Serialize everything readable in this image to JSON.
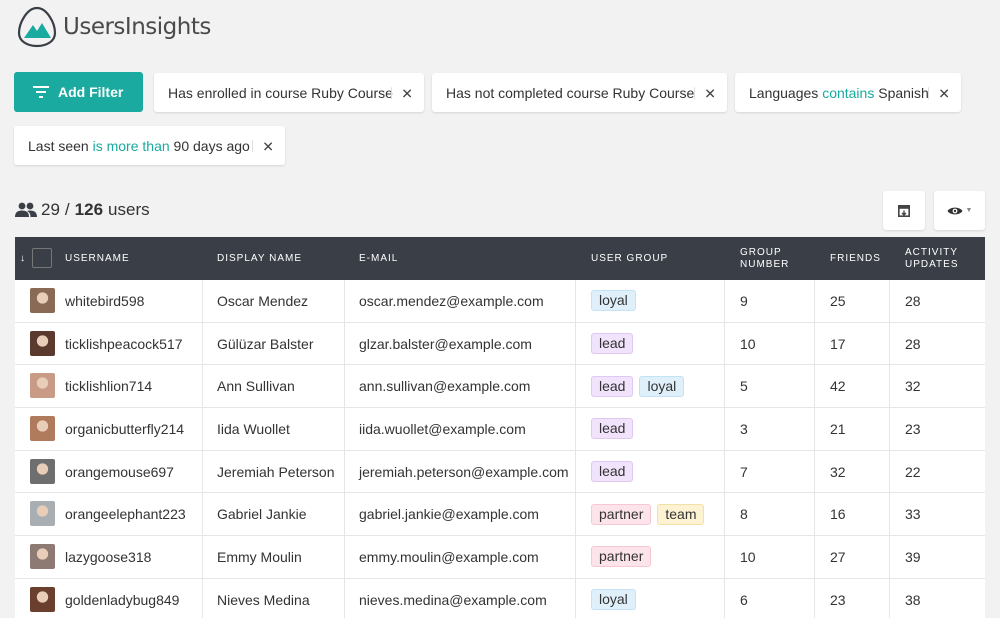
{
  "app": {
    "name": "UsersInsights"
  },
  "colors": {
    "accent": "#1aaa9f",
    "header_bg": "#3a3f47"
  },
  "toolbar": {
    "add_filter_label": "Add Filter"
  },
  "filters": [
    {
      "prefix": "Has enrolled in course Ruby Course",
      "operator": "",
      "suffix": ""
    },
    {
      "prefix": "Has not completed course Ruby Course",
      "operator": "",
      "suffix": ""
    },
    {
      "prefix": "Languages ",
      "operator": "contains",
      "suffix": " Spanish"
    },
    {
      "prefix": "Last seen ",
      "operator": "is more than",
      "suffix": " 90 days ago"
    }
  ],
  "summary": {
    "filtered": "29",
    "separator": "/",
    "total": "126",
    "unit": "users"
  },
  "table": {
    "sort_indicator": "↓",
    "columns": [
      "Username",
      "Display Name",
      "E-mail",
      "User Group",
      "Group Number",
      "Friends",
      "Activity Updates"
    ],
    "rows": [
      {
        "username": "whitebird598",
        "display_name": "Oscar Mendez",
        "email": "oscar.mendez@example.com",
        "groups": [
          "loyal"
        ],
        "group_number": "9",
        "friends": "25",
        "activity": "28",
        "avatar_color": "#8a6a55"
      },
      {
        "username": "ticklishpeacock517",
        "display_name": "Gülüzar Balster",
        "email": "glzar.balster@example.com",
        "groups": [
          "lead"
        ],
        "group_number": "10",
        "friends": "17",
        "activity": "28",
        "avatar_color": "#5a3a2e"
      },
      {
        "username": "ticklishlion714",
        "display_name": "Ann Sullivan",
        "email": "ann.sullivan@example.com",
        "groups": [
          "lead",
          "loyal"
        ],
        "group_number": "5",
        "friends": "42",
        "activity": "32",
        "avatar_color": "#c99a85"
      },
      {
        "username": "organicbutterfly214",
        "display_name": "Iida Wuollet",
        "email": "iida.wuollet@example.com",
        "groups": [
          "lead"
        ],
        "group_number": "3",
        "friends": "21",
        "activity": "23",
        "avatar_color": "#b07a5c"
      },
      {
        "username": "orangemouse697",
        "display_name": "Jeremiah Peterson",
        "email": "jeremiah.peterson@example.com",
        "groups": [
          "lead"
        ],
        "group_number": "7",
        "friends": "32",
        "activity": "22",
        "avatar_color": "#6e6e6e"
      },
      {
        "username": "orangeelephant223",
        "display_name": "Gabriel Jankie",
        "email": "gabriel.jankie@example.com",
        "groups": [
          "partner",
          "team"
        ],
        "group_number": "8",
        "friends": "16",
        "activity": "33",
        "avatar_color": "#a9aeb3"
      },
      {
        "username": "lazygoose318",
        "display_name": "Emmy Moulin",
        "email": "emmy.moulin@example.com",
        "groups": [
          "partner"
        ],
        "group_number": "10",
        "friends": "27",
        "activity": "39",
        "avatar_color": "#8d7b73"
      },
      {
        "username": "goldenladybug849",
        "display_name": "Nieves Medina",
        "email": "nieves.medina@example.com",
        "groups": [
          "loyal"
        ],
        "group_number": "6",
        "friends": "23",
        "activity": "38",
        "avatar_color": "#6b3f2e"
      }
    ]
  },
  "icons": {
    "logo": "mountain-logo-icon",
    "filter": "filter-lines-icon",
    "users": "users-icon",
    "export": "export-icon",
    "columns": "eye-icon",
    "dropdown": "caret-down-icon",
    "close": "close-icon"
  }
}
